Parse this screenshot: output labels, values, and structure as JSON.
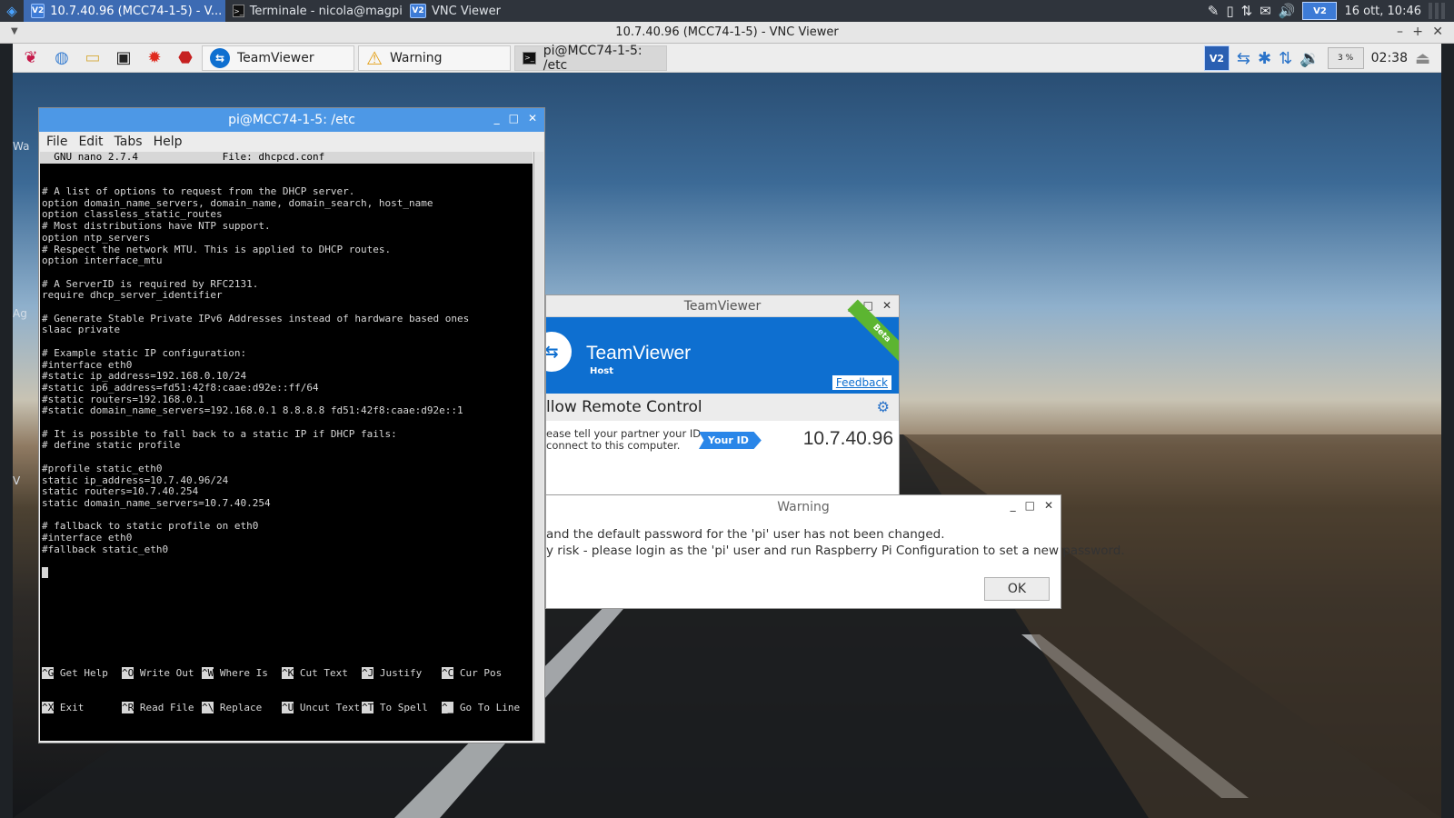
{
  "host_taskbar": {
    "tasks": [
      {
        "label": "10.7.40.96 (MCC74-1-5) - V...",
        "icon": "vnc-viewer-icon",
        "active": true
      },
      {
        "label": "Terminale - nicola@magpi...",
        "icon": "terminal-icon",
        "active": false
      },
      {
        "label": "VNC Viewer",
        "icon": "vnc-viewer-icon",
        "active": false
      }
    ],
    "tray_icons": [
      "notes-icon",
      "battery-icon",
      "network-icon",
      "mail-icon",
      "volume-icon",
      "vnc-tray-icon"
    ],
    "vnc_tray_label": "V2",
    "clock": "16 ott, 10:46"
  },
  "vnc_window": {
    "title": "10.7.40.96 (MCC74-1-5) - VNC Viewer"
  },
  "remote_taskbar": {
    "launchers": [
      "raspberry-menu-icon",
      "web-browser-icon",
      "file-manager-icon",
      "terminal-icon",
      "wolfram-icon",
      "mathematica-icon"
    ],
    "tasks": [
      {
        "label": "TeamViewer",
        "icon": "teamviewer-icon"
      },
      {
        "label": "Warning",
        "icon": "warning-icon"
      },
      {
        "label": "pi@MCC74-1-5: /etc",
        "icon": "terminal-icon"
      }
    ],
    "tray": {
      "vnc_label": "V2",
      "cpu": "3 %",
      "clock": "02:38"
    }
  },
  "terminal": {
    "title": "pi@MCC74-1-5: /etc",
    "menu": [
      "File",
      "Edit",
      "Tabs",
      "Help"
    ],
    "nano_header": "  GNU nano 2.7.4              File: dhcpcd.conf",
    "lines": [
      "# A list of options to request from the DHCP server.",
      "option domain_name_servers, domain_name, domain_search, host_name",
      "option classless_static_routes",
      "# Most distributions have NTP support.",
      "option ntp_servers",
      "# Respect the network MTU. This is applied to DHCP routes.",
      "option interface_mtu",
      "",
      "# A ServerID is required by RFC2131.",
      "require dhcp_server_identifier",
      "",
      "# Generate Stable Private IPv6 Addresses instead of hardware based ones",
      "slaac private",
      "",
      "# Example static IP configuration:",
      "#interface eth0",
      "#static ip_address=192.168.0.10/24",
      "#static ip6_address=fd51:42f8:caae:d92e::ff/64",
      "#static routers=192.168.0.1",
      "#static domain_name_servers=192.168.0.1 8.8.8.8 fd51:42f8:caae:d92e::1",
      "",
      "# It is possible to fall back to a static IP if DHCP fails:",
      "# define static profile",
      "",
      "#profile static_eth0",
      "static ip_address=10.7.40.96/24",
      "static routers=10.7.40.254",
      "static domain_name_servers=10.7.40.254",
      "",
      "# fallback to static profile on eth0",
      "#interface eth0",
      "#fallback static_eth0"
    ],
    "shortcuts_row1": [
      {
        "key": "^G",
        "label": "Get Help"
      },
      {
        "key": "^O",
        "label": "Write Out"
      },
      {
        "key": "^W",
        "label": "Where Is"
      },
      {
        "key": "^K",
        "label": "Cut Text"
      },
      {
        "key": "^J",
        "label": "Justify"
      },
      {
        "key": "^C",
        "label": "Cur Pos"
      }
    ],
    "shortcuts_row2": [
      {
        "key": "^X",
        "label": "Exit"
      },
      {
        "key": "^R",
        "label": "Read File"
      },
      {
        "key": "^\\",
        "label": "Replace"
      },
      {
        "key": "^U",
        "label": "Uncut Text"
      },
      {
        "key": "^T",
        "label": "To Spell"
      },
      {
        "key": "^_",
        "label": "Go To Line"
      }
    ]
  },
  "teamviewer": {
    "title": "TeamViewer",
    "brand": "TeamViewer",
    "subtitle": "Host",
    "beta": "Beta",
    "feedback": "Feedback",
    "section_title": "llow Remote Control",
    "instruction_line1": "ease tell your partner your ID",
    "instruction_line2": " connect to this computer.",
    "your_id_label": "Your ID",
    "id_value": "10.7.40.96"
  },
  "warning": {
    "title": "Warning",
    "line1": " and the default password for the 'pi' user has not been changed.",
    "line2": "y risk - please login as the 'pi' user and run Raspberry Pi Configuration to set a new password.",
    "ok_label": "OK"
  },
  "desktop_partial_labels": [
    "Wa",
    "Ag",
    "V"
  ]
}
